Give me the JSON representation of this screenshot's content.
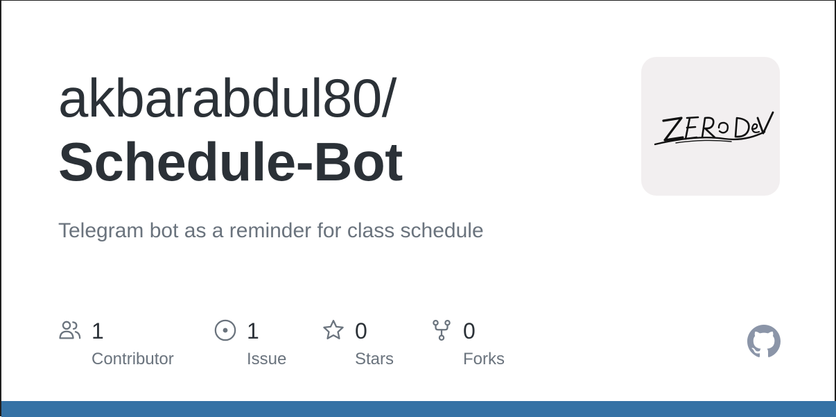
{
  "repo": {
    "owner": "akbarabdul80/",
    "name": "Schedule-Bot",
    "description": "Telegram bot as a reminder for class schedule",
    "avatar_icon": "zerodev-logo-avatar"
  },
  "stats": [
    {
      "icon": "people-icon",
      "value": "1",
      "label": "Contributor"
    },
    {
      "icon": "issue-icon",
      "value": "1",
      "label": "Issue"
    },
    {
      "icon": "star-icon",
      "value": "0",
      "label": "Stars"
    },
    {
      "icon": "fork-icon",
      "value": "0",
      "label": "Forks"
    }
  ],
  "colors": {
    "title": "#2b3137",
    "muted": "#6a737d",
    "icon": "#6a737d",
    "github_mark": "#8b95a8",
    "bottom_bar": "#3572a5",
    "avatar_bg": "#f2eff0"
  },
  "brand_icon": "github-mark-icon"
}
